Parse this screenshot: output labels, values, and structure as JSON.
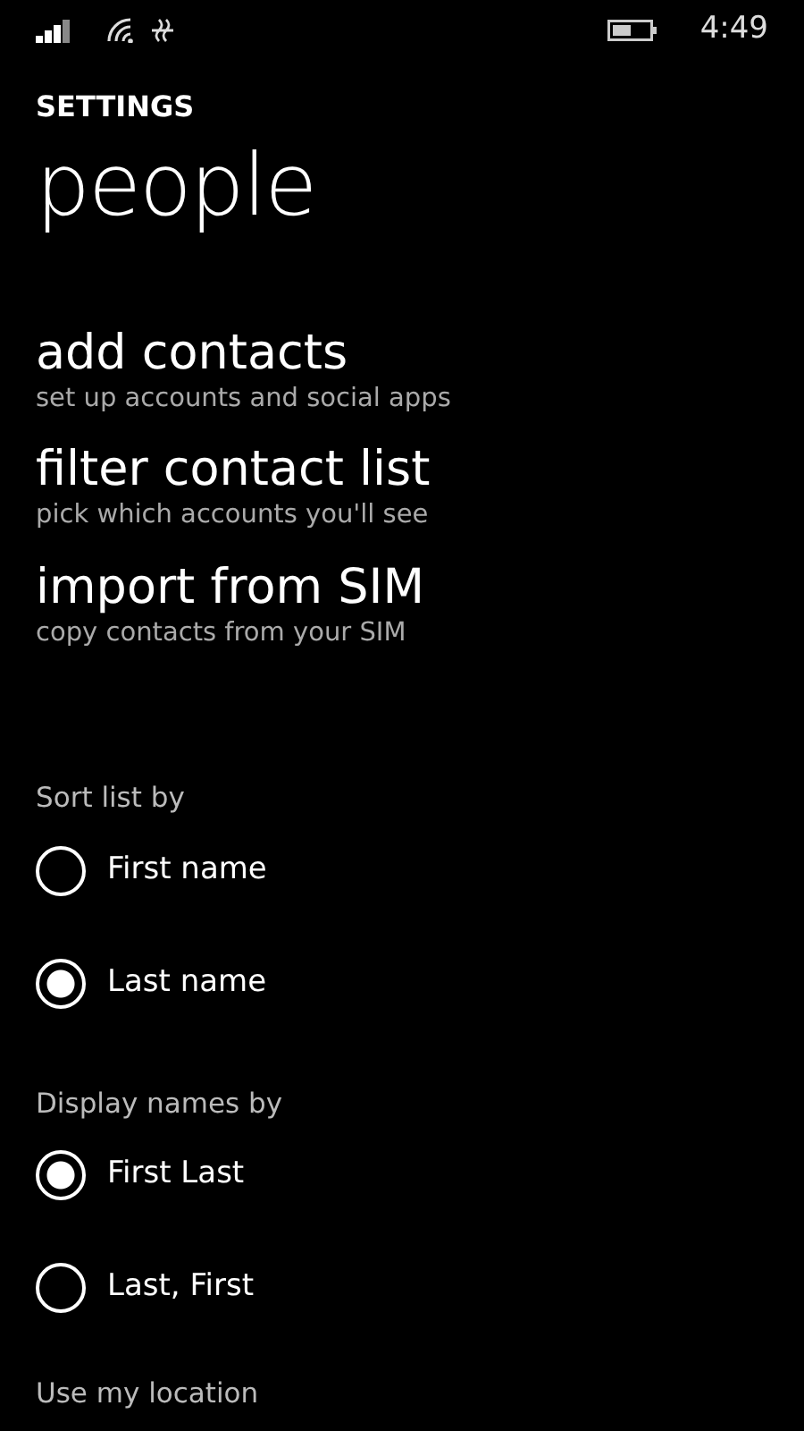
{
  "status_bar": {
    "time": "4:49"
  },
  "header": {
    "section": "SETTINGS",
    "title": "people"
  },
  "links": [
    {
      "title": "add contacts",
      "subtitle": "set up accounts and social apps"
    },
    {
      "title": "filter contact list",
      "subtitle": "pick which accounts you'll see"
    },
    {
      "title": "import from SIM",
      "subtitle": "copy contacts from your SIM"
    }
  ],
  "groups": [
    {
      "label": "Sort list by",
      "options": [
        {
          "label": "First name",
          "selected": false
        },
        {
          "label": "Last name",
          "selected": true
        }
      ]
    },
    {
      "label": "Display names by",
      "options": [
        {
          "label": "First Last",
          "selected": true
        },
        {
          "label": "Last, First",
          "selected": false
        }
      ]
    }
  ],
  "location": {
    "label": "Use my location"
  }
}
